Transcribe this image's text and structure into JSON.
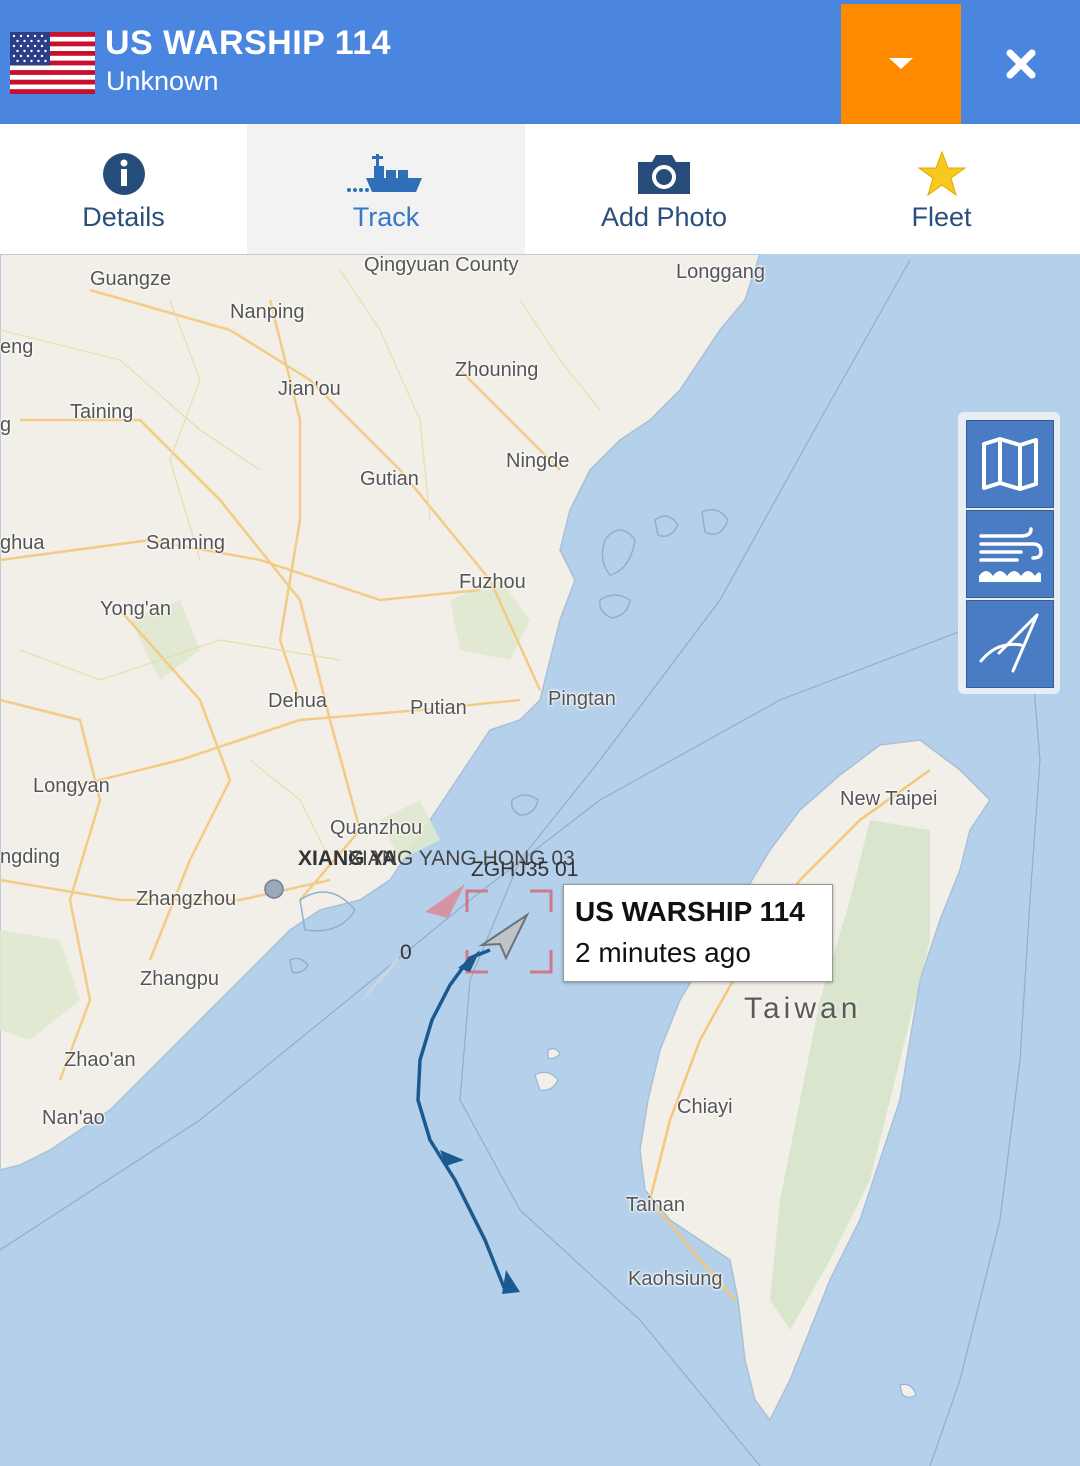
{
  "header": {
    "vessel_name": "US WARSHIP 114",
    "vessel_type": "Unknown",
    "flag": "United States",
    "dropdown_icon": "chevron-down",
    "close_icon": "close",
    "colors": {
      "bar": "#4a86df",
      "dropdown": "#ff8a00"
    }
  },
  "tabs": [
    {
      "label": "Details",
      "icon": "info-icon",
      "active": false
    },
    {
      "label": "Track",
      "icon": "ship-icon",
      "active": true
    },
    {
      "label": "Add Photo",
      "icon": "camera-icon",
      "active": false
    },
    {
      "label": "Fleet",
      "icon": "star-icon",
      "active": false
    }
  ],
  "map": {
    "cities": {
      "guangze": "Guangze",
      "qingyuan": "Qingyuan County",
      "longgang": "Longgang",
      "nanping": "Nanping",
      "eng": "eng",
      "zhouning": "Zhouning",
      "jianou": "Jian'ou",
      "taining": "Taining",
      "g": "g",
      "ningde": "Ningde",
      "gutian": "Gutian",
      "ghua": "ghua",
      "sanming": "Sanming",
      "fuzhou": "Fuzhou",
      "yongan": "Yong'an",
      "dehua": "Dehua",
      "putian": "Putian",
      "pingtan": "Pingtan",
      "longyan": "Longyan",
      "quanzhou": "Quanzhou",
      "ngding": "ngding",
      "zhangzhou": "Zhangzhou",
      "zhangpu": "Zhangpu",
      "zhaoan": "Zhao'an",
      "nanao": "Nan'ao",
      "new_taipei": "New Taipei",
      "chiayi": "Chiayi",
      "tainan": "Tainan",
      "kaohsiung": "Kaohsiung"
    },
    "region_label": "Taiwan",
    "vessel_labels": {
      "xiang": "XIANG YA",
      "xiangyang": "XIANG YANG HONG 03",
      "zghj": "ZGHJ35 01",
      "zero": "0"
    },
    "track_color": "#1b5a8f"
  },
  "controls": [
    {
      "name": "map-layers-button",
      "icon": "map-icon"
    },
    {
      "name": "weather-button",
      "icon": "wind-waves-icon"
    },
    {
      "name": "measure-button",
      "icon": "compass-icon"
    }
  ],
  "popup": {
    "vessel_name": "US WARSHIP 114",
    "last_seen": "2 minutes ago"
  }
}
